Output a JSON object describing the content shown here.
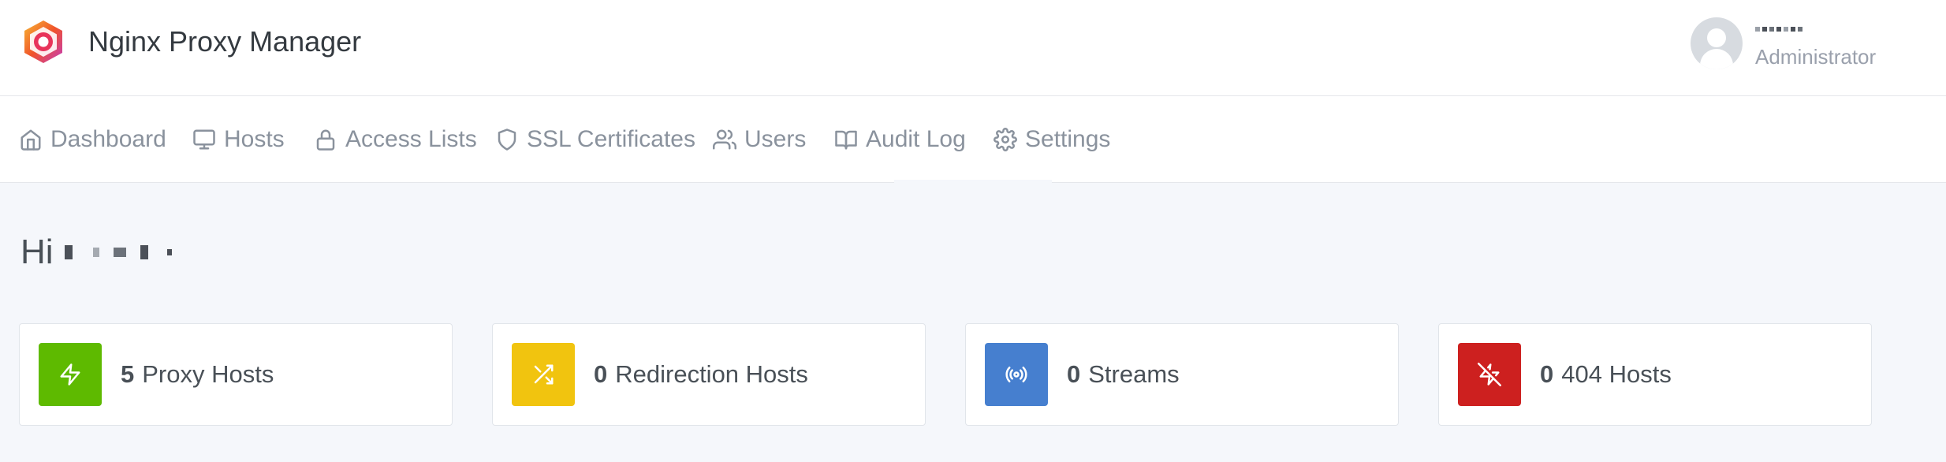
{
  "app": {
    "title": "Nginx Proxy Manager"
  },
  "user": {
    "role": "Administrator"
  },
  "nav": {
    "items": [
      {
        "label": "Dashboard",
        "icon": "home-icon"
      },
      {
        "label": "Hosts",
        "icon": "monitor-icon"
      },
      {
        "label": "Access Lists",
        "icon": "lock-icon"
      },
      {
        "label": "SSL Certificates",
        "icon": "shield-icon"
      },
      {
        "label": "Users",
        "icon": "users-icon"
      },
      {
        "label": "Audit Log",
        "icon": "book-icon"
      },
      {
        "label": "Settings",
        "icon": "gear-icon"
      }
    ]
  },
  "greeting": {
    "prefix": "Hi"
  },
  "cards": [
    {
      "count": "5",
      "label": "Proxy Hosts",
      "icon": "zap-icon",
      "color": "#5eba00"
    },
    {
      "count": "0",
      "label": "Redirection Hosts",
      "icon": "shuffle-icon",
      "color": "#f1c40f"
    },
    {
      "count": "0",
      "label": "Streams",
      "icon": "radio-icon",
      "color": "#467fcf"
    },
    {
      "count": "0",
      "label": "404 Hosts",
      "icon": "zap-off-icon",
      "color": "#cd201f"
    }
  ]
}
